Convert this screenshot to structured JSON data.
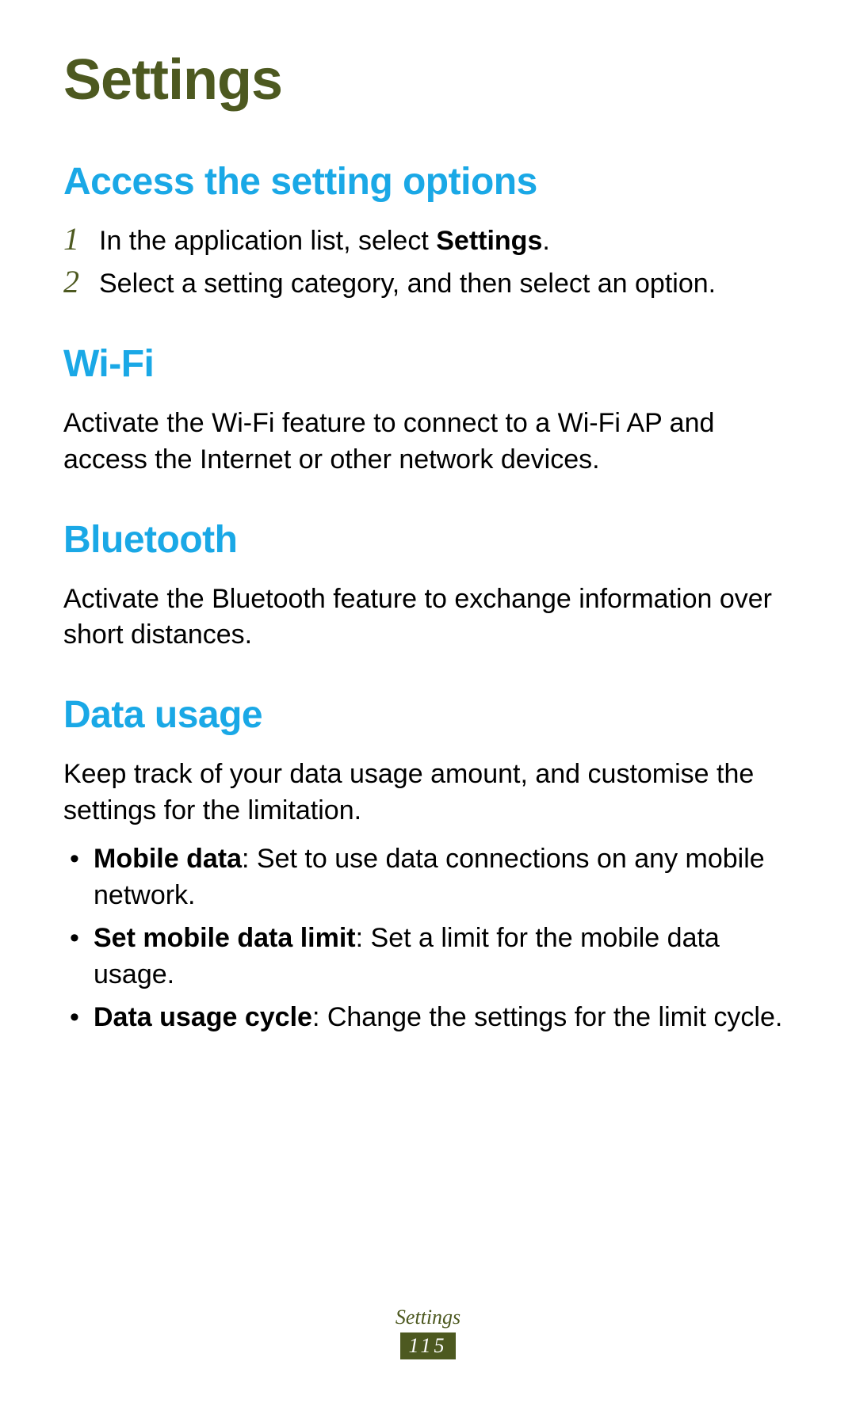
{
  "page_title": "Settings",
  "sections": {
    "access": {
      "heading": "Access the setting options",
      "steps": [
        {
          "num": "1",
          "before": "In the application list, select ",
          "bold": "Settings",
          "after": "."
        },
        {
          "num": "2",
          "text": "Select a setting category, and then select an option."
        }
      ]
    },
    "wifi": {
      "heading": "Wi-Fi",
      "body": "Activate the Wi-Fi feature to connect to a Wi-Fi AP and access the Internet or other network devices."
    },
    "bluetooth": {
      "heading": "Bluetooth",
      "body": "Activate the Bluetooth feature to exchange information over short distances."
    },
    "data_usage": {
      "heading": "Data usage",
      "body": "Keep track of your data usage amount, and customise the settings for the limitation.",
      "bullets": [
        {
          "bold": "Mobile data",
          "text": ": Set to use data connections on any mobile network."
        },
        {
          "bold": "Set mobile data limit",
          "text": ": Set a limit for the mobile data usage."
        },
        {
          "bold": "Data usage cycle",
          "text": ": Change the settings for the limit cycle."
        }
      ]
    }
  },
  "footer": {
    "label": "Settings",
    "page_number": "115"
  }
}
